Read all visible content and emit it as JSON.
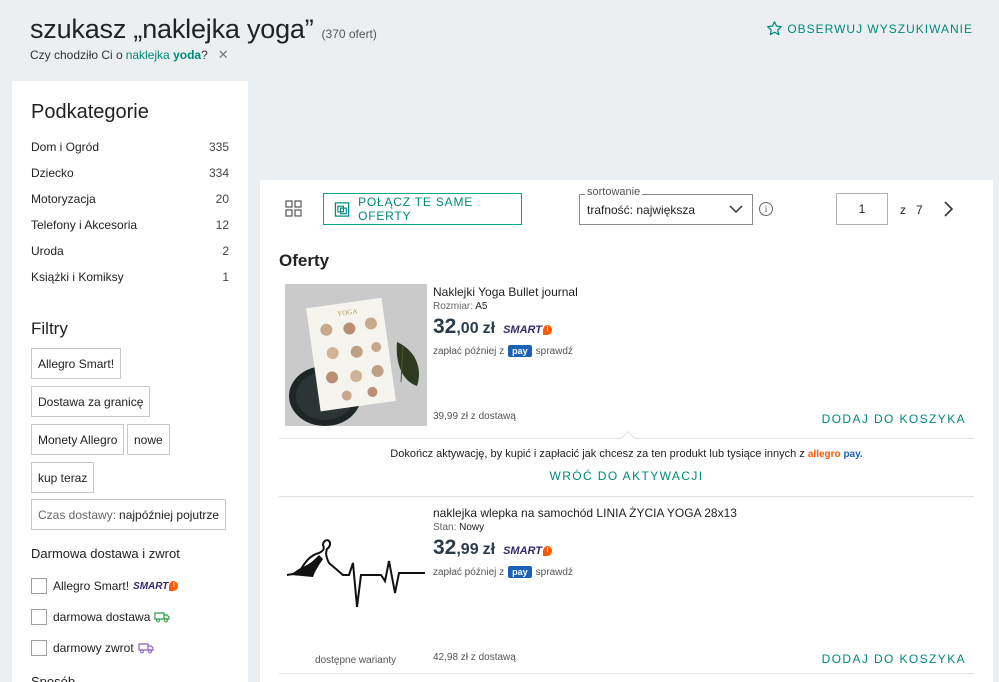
{
  "header": {
    "title": "szukasz „naklejka yoga”",
    "count": "(370 ofert)",
    "did_you_mean_prefix": "Czy chodziło Ci o",
    "did_you_mean_word1": "naklejka",
    "did_you_mean_word2": "yoda",
    "did_you_mean_suffix": "?",
    "close": "✕",
    "observe_label": "OBSERWUJ WYSZUKIWANIE"
  },
  "sidebar": {
    "subcategories_title": "Podkategorie",
    "subcategories": [
      {
        "name": "Dom i Ogród",
        "count": "335"
      },
      {
        "name": "Dziecko",
        "count": "334"
      },
      {
        "name": "Motoryzacja",
        "count": "20"
      },
      {
        "name": "Telefony i Akcesoria",
        "count": "12"
      },
      {
        "name": "Uroda",
        "count": "2"
      },
      {
        "name": "Książki i Komiksy",
        "count": "1"
      }
    ],
    "filters_title": "Filtry",
    "chips": {
      "allegro_smart": "Allegro Smart!",
      "abroad": "Dostawa za granicę",
      "monety": "Monety Allegro",
      "nowe": "nowe",
      "kup_teraz": "kup teraz",
      "delivery_time_label": "Czas dostawy:",
      "delivery_time_value": "najpóźniej pojutrze"
    },
    "free_title": "Darmowa dostawa i zwrot",
    "checkboxes": {
      "smart": "Allegro Smart!",
      "free_delivery": "darmowa dostawa",
      "free_return": "darmowy zwrot"
    },
    "smart_badge": "SMART",
    "bottom_cut_title": "Sposób"
  },
  "toolbar": {
    "combine_label": "POŁĄCZ TE SAME OFERTY",
    "sort_label": "sortowanie",
    "sort_value": "trafność: największa",
    "info": "i",
    "page_current": "1",
    "page_of": "z",
    "page_total": "7"
  },
  "offers_title": "Oferty",
  "offers": [
    {
      "title": "Naklejki Yoga Bullet journal",
      "attr_label": "Rozmiar:",
      "attr_value": "A5",
      "price_int": "32",
      "price_dec": ",00",
      "currency": "zł",
      "smart": "SMART",
      "pay_prefix": "zapłać później z",
      "pay_badge": "pay",
      "pay_suffix": "sprawdź",
      "shipping": "39,99 zł z dostawą",
      "cart": "DODAJ DO KOSZYKA"
    },
    {
      "title": "naklejka wlepka na samochód LINIA ŻYCIA YOGA 28x13",
      "attr_label": "Stan:",
      "attr_value": "Nowy",
      "price_int": "32",
      "price_dec": ",99",
      "currency": "zł",
      "smart": "SMART",
      "pay_prefix": "zapłać później z",
      "pay_badge": "pay",
      "pay_suffix": "sprawdź",
      "shipping": "42,98 zł z dostawą",
      "cart": "DODAJ DO KOSZYKA",
      "variants": "dostępne warianty"
    }
  ],
  "activation": {
    "message": "Dokończ aktywację, by kupić i zapłacić jak chcesz za ten produkt lub tysiące innych z",
    "brand_allegro": "allegro",
    "brand_pay": "pay.",
    "back": "WRÓĆ DO AKTYWACJI"
  },
  "colors": {
    "accent": "#00897b",
    "smart": "#37296b",
    "smart_bang": "#ff5a00",
    "pay": "#1a61b8"
  }
}
